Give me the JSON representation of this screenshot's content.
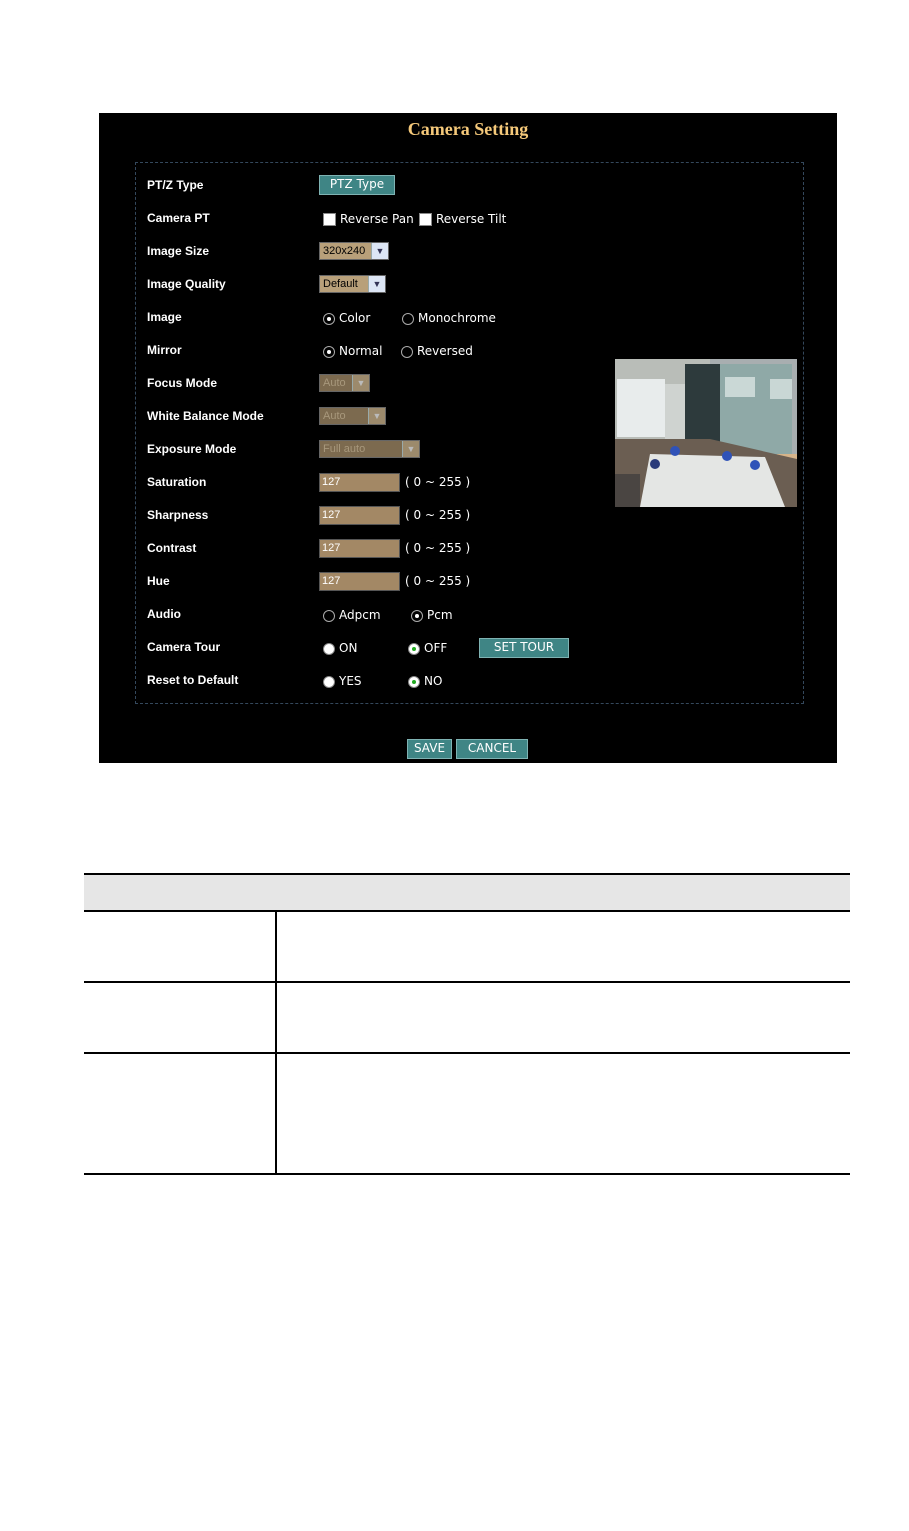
{
  "title": "Camera Setting",
  "rows": {
    "ptz_type": {
      "label": "PT/Z Type",
      "button": "PTZ Type"
    },
    "camera_pt": {
      "label": "Camera PT",
      "reverse_pan": "Reverse Pan",
      "reverse_tilt": "Reverse Tilt"
    },
    "image_size": {
      "label": "Image Size",
      "value": "320x240"
    },
    "image_quality": {
      "label": "Image Quality",
      "value": "Default"
    },
    "image": {
      "label": "Image",
      "opt1": "Color",
      "opt2": "Monochrome",
      "selected": "Color"
    },
    "mirror": {
      "label": "Mirror",
      "opt1": "Normal",
      "opt2": "Reversed",
      "selected": "Normal"
    },
    "focus_mode": {
      "label": "Focus Mode",
      "value": "Auto"
    },
    "white_balance": {
      "label": "White Balance Mode",
      "value": "Auto"
    },
    "exposure_mode": {
      "label": "Exposure Mode",
      "value": "Full auto"
    },
    "saturation": {
      "label": "Saturation",
      "value": "127",
      "range": "( 0 ~ 255 )"
    },
    "sharpness": {
      "label": "Sharpness",
      "value": "127",
      "range": "( 0 ~ 255 )"
    },
    "contrast": {
      "label": "Contrast",
      "value": "127",
      "range": "( 0 ~ 255 )"
    },
    "hue": {
      "label": "Hue",
      "value": "127",
      "range": "( 0 ~ 255 )"
    },
    "audio": {
      "label": "Audio",
      "opt1": "Adpcm",
      "opt2": "Pcm",
      "selected": "Pcm"
    },
    "camera_tour": {
      "label": "Camera Tour",
      "opt1": "ON",
      "opt2": "OFF",
      "selected": "OFF",
      "button": "SET TOUR"
    },
    "reset": {
      "label": "Reset to Default",
      "opt1": "YES",
      "opt2": "NO",
      "selected": "NO"
    }
  },
  "buttons": {
    "save": "SAVE",
    "cancel": "CANCEL"
  },
  "colors": {
    "title": "#f5c97a",
    "button": "#3f8585",
    "panel": "#000000",
    "input": "#a38865"
  }
}
